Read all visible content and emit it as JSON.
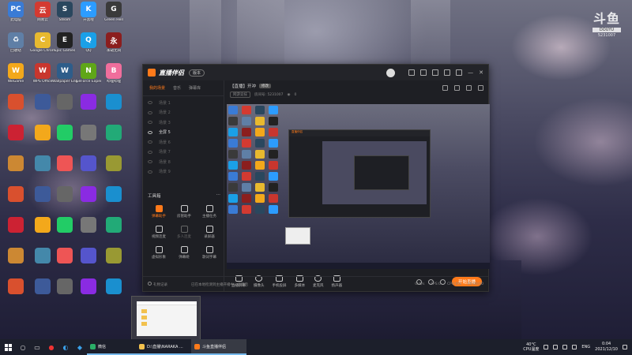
{
  "desktop_icons": [
    {
      "label": "此电脑",
      "color": "#3a7bd5",
      "glyph": "PC"
    },
    {
      "label": "网易云",
      "color": "#d33a31",
      "glyph": "云"
    },
    {
      "label": "Steam",
      "color": "#2a475e",
      "glyph": "S"
    },
    {
      "label": "开黑啦",
      "color": "#2c9cff",
      "glyph": "K"
    },
    {
      "label": "Green Hell",
      "color": "#3a3a3a",
      "glyph": "G"
    },
    {
      "label": "回收站",
      "color": "#5f7fa6",
      "glyph": "♻"
    },
    {
      "label": "Google Chrome",
      "color": "#e8b92f",
      "glyph": "C"
    },
    {
      "label": "Epic Games",
      "color": "#222",
      "glyph": "E"
    },
    {
      "label": "QQ",
      "color": "#1aa0e8",
      "glyph": "Q"
    },
    {
      "label": "永劫无间",
      "color": "#8b1e1e",
      "glyph": "永"
    },
    {
      "label": "WeGame",
      "color": "#f3a81b",
      "glyph": "W"
    },
    {
      "label": "WPS Office",
      "color": "#c8362e",
      "glyph": "W"
    },
    {
      "label": "Wallpaper Engine",
      "color": "#2e5d8a",
      "glyph": "W"
    },
    {
      "label": "GeForce Experience",
      "color": "#5fa618",
      "glyph": "N"
    },
    {
      "label": "哔哩哔哩",
      "color": "#f06e9c",
      "glyph": "B"
    }
  ],
  "watermark": {
    "logo": "斗鱼",
    "bar": "DOUYU",
    "room_id": "5231007"
  },
  "app": {
    "title": "直播伴侣",
    "version_badge": "版本",
    "sidebar_tabs": [
      "我的场景",
      "音乐",
      "弹幕库"
    ],
    "scenes": [
      "场景 1",
      "场景 2",
      "场景 3",
      "全屏 5",
      "场景 6",
      "场景 7",
      "场景 8",
      "场景 9"
    ],
    "active_scene_index": 3,
    "tools_title": "工具箱",
    "tools": [
      "弹幕助手",
      "房管助手",
      "主播任务",
      "视频连麦",
      "多人连麦",
      "录屏器",
      "虚拟形象",
      "弹幕姬",
      "歌词字幕"
    ],
    "highlighted_tool_index": 0,
    "room": {
      "title": "【直播】开冲",
      "tag": "修改",
      "category": "网游竞技",
      "room_label": "房间号: 5231007",
      "viewers": "0"
    },
    "controls": [
      "直播屏幕",
      "摄像头",
      "手机投屏",
      "多媒体",
      "麦克风",
      "扬声器"
    ],
    "start_live_label": "开始直播",
    "status": {
      "left": "礼物记录",
      "message": "已在本地检测到主播开播中，请稍后",
      "bitrate": "0kb/s",
      "fps": "FPS:0",
      "cpu": "CPU:0%",
      "timer": "00:00:00"
    }
  },
  "taskbar": {
    "apps": [
      {
        "label": "微信",
        "color": "#2aae67",
        "state": "open"
      },
      {
        "label": "D:\\直播\\NARAKA ...",
        "color": "#f2c14e",
        "state": "open"
      },
      {
        "label": "斗鱼直播伴侣",
        "color": "#ff7a1a",
        "state": "active"
      }
    ],
    "temp": "40°C",
    "temp_label": "CPU温度",
    "ime": "ENG",
    "time": "0:04",
    "date": "2021/12/10"
  }
}
